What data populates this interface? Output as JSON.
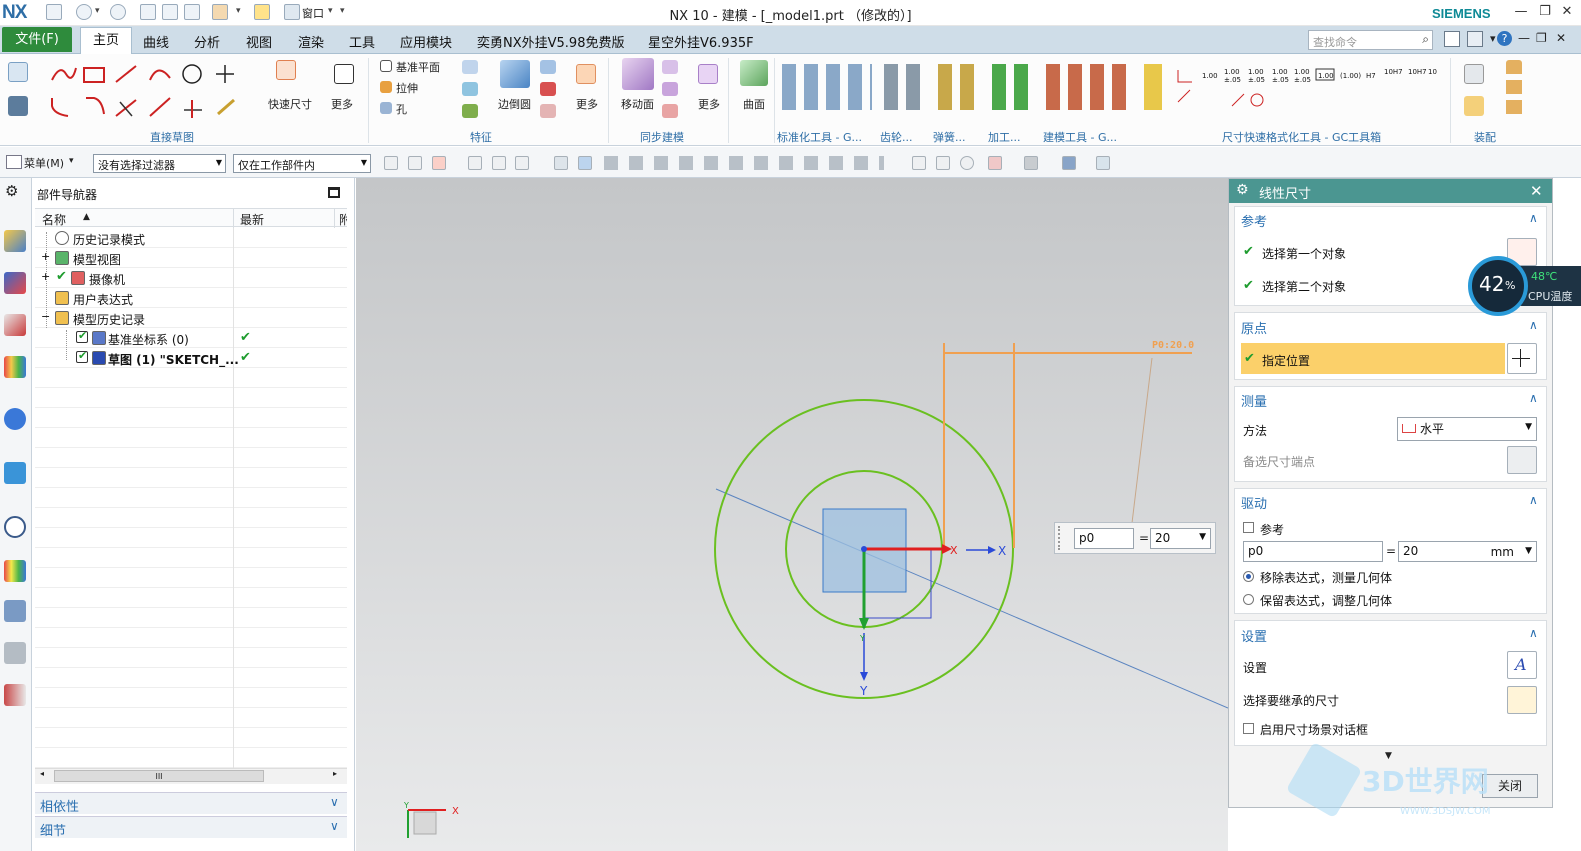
{
  "app": {
    "logo": "NX",
    "title": "NX 10 - 建模 - [_model1.prt （修改的）]",
    "brand": "SIEMENS",
    "window_menu": "窗口"
  },
  "menu": {
    "file": "文件(F)",
    "tabs": [
      "主页",
      "曲线",
      "分析",
      "视图",
      "渲染",
      "工具",
      "应用模块",
      "奕勇NX外挂V5.98免费版",
      "星空外挂V6.935F"
    ],
    "search_placeholder": "查找命令"
  },
  "ribbon": {
    "labels": {
      "quick_dim": "快速尺寸",
      "more1": "更多",
      "datum_plane": "基准平面",
      "extrude": "拉伸",
      "hole": "孔",
      "edge_blend": "边倒圆",
      "more2": "更多",
      "move_face": "移动面",
      "more3": "更多",
      "surface": "曲面"
    },
    "groups": {
      "direct_sketch": "直接草图",
      "feature": "特征",
      "sync": "同步建模",
      "std_tools": "标准化工具 - G...",
      "gear": "齿轮...",
      "spring": "弹簧...",
      "machining": "加工...",
      "build_tools": "建模工具 - G...",
      "dim_tools": "尺寸快速格式化工具 - GC工具箱",
      "assembly": "装配"
    },
    "fit_labels": [
      "1.00",
      "1.00\n±.05",
      "1.00\n±.05",
      "1.00\n±.05",
      "1.00\n±.05",
      "(1.00)",
      "H7",
      "10H7",
      "10H7",
      "10\nH7"
    ]
  },
  "toolbar": {
    "menu": "菜单(M)",
    "filter": "没有选择过滤器",
    "scope": "仅在工作部件内"
  },
  "navigator": {
    "title": "部件导航器",
    "col_name": "名称",
    "col_latest": "最新",
    "col_dep": "附",
    "rows": [
      {
        "label": "历史记录模式",
        "indent": 0
      },
      {
        "label": "模型视图",
        "indent": 0
      },
      {
        "label": "摄像机",
        "indent": 0
      },
      {
        "label": "用户表达式",
        "indent": 0
      },
      {
        "label": "模型历史记录",
        "indent": 0
      },
      {
        "label": "基准坐标系 (0)",
        "indent": 1
      },
      {
        "label": "草图 (1) \"SKETCH_...",
        "indent": 1
      }
    ],
    "scroll_mid": "III",
    "dependency": "相依性",
    "details": "细节"
  },
  "canvas": {
    "dim_label": "P0:20.0",
    "x_axis": "X",
    "y_axis": "Y",
    "y_small": "Y",
    "input_name": "p0",
    "input_eq": "=",
    "input_value": "20"
  },
  "dialog": {
    "title": "线性尺寸",
    "ref": {
      "header": "参考",
      "first": "选择第一个对象",
      "second": "选择第二个对象"
    },
    "origin": {
      "header": "原点",
      "specify": "指定位置"
    },
    "measure": {
      "header": "测量",
      "method_label": "方法",
      "method_value": "水平",
      "alt_dim": "备选尺寸端点"
    },
    "drive": {
      "header": "驱动",
      "ref_label": "参考",
      "expr_name": "p0",
      "eq": "=",
      "value": "20",
      "unit": "mm",
      "opt1": "移除表达式，测量几何体",
      "opt2": "保留表达式，调整几何体"
    },
    "settings": {
      "header": "设置",
      "settings": "设置",
      "inherit": "选择要继承的尺寸",
      "scene": "启用尺寸场景对话框"
    },
    "close": "关闭"
  },
  "overlay": {
    "cpu_percent": "42",
    "cpu_unit": "%",
    "temp": "48℃",
    "temp_label": "CPU温度"
  },
  "watermark": {
    "brand": "3D世界网",
    "url": "WWW.3DSJW.COM"
  }
}
